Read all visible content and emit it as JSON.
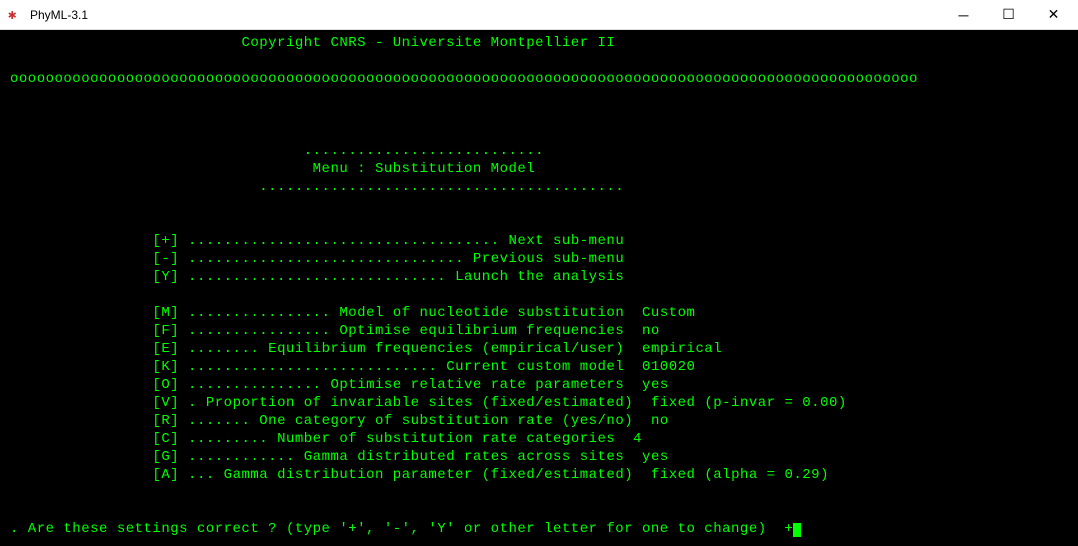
{
  "window": {
    "title": "PhyML-3.1"
  },
  "copyright": "Copyright CNRS - Universite Montpellier II",
  "divider": "oooooooooooooooooooooooooooooooooooooooooooooooooooooooooooooooooooooooooooooooooooooooooooooooooooooo",
  "menu": {
    "dots_top": "...........................",
    "title": "Menu : Substitution Model",
    "dots_bottom": "........................................."
  },
  "nav": [
    {
      "key": "[+]",
      "dots": "...................................",
      "label": "Next sub-menu"
    },
    {
      "key": "[-]",
      "dots": "...............................",
      "label": "Previous sub-menu"
    },
    {
      "key": "[Y]",
      "dots": ".............................",
      "label": "Launch the analysis"
    }
  ],
  "options": [
    {
      "key": "[M]",
      "dots": "................",
      "label": "Model of nucleotide substitution",
      "value": "Custom"
    },
    {
      "key": "[F]",
      "dots": "................",
      "label": "Optimise equilibrium frequencies",
      "value": "no"
    },
    {
      "key": "[E]",
      "dots": "........",
      "label": "Equilibrium frequencies (empirical/user)",
      "value": "empirical"
    },
    {
      "key": "[K]",
      "dots": "............................",
      "label": "Current custom model",
      "value": "010020"
    },
    {
      "key": "[O]",
      "dots": "...............",
      "label": "Optimise relative rate parameters",
      "value": "yes"
    },
    {
      "key": "[V]",
      "dots": ". ",
      "label": "Proportion of invariable sites (fixed/estimated)",
      "value": "fixed (p-invar = 0.00)"
    },
    {
      "key": "[R]",
      "dots": ".......",
      "label": "One category of substitution rate (yes/no)",
      "value": "no"
    },
    {
      "key": "[C]",
      "dots": ".........",
      "label": "Number of substitution rate categories",
      "value": "4"
    },
    {
      "key": "[G]",
      "dots": "............",
      "label": "Gamma distributed rates across sites",
      "value": "yes"
    },
    {
      "key": "[A]",
      "dots": "...",
      "label": "Gamma distribution parameter (fixed/estimated)",
      "value": "fixed (alpha = 0.29)"
    }
  ],
  "prompt": ". Are these settings correct ? (type '+', '-', 'Y' or other letter for one to change)  +"
}
